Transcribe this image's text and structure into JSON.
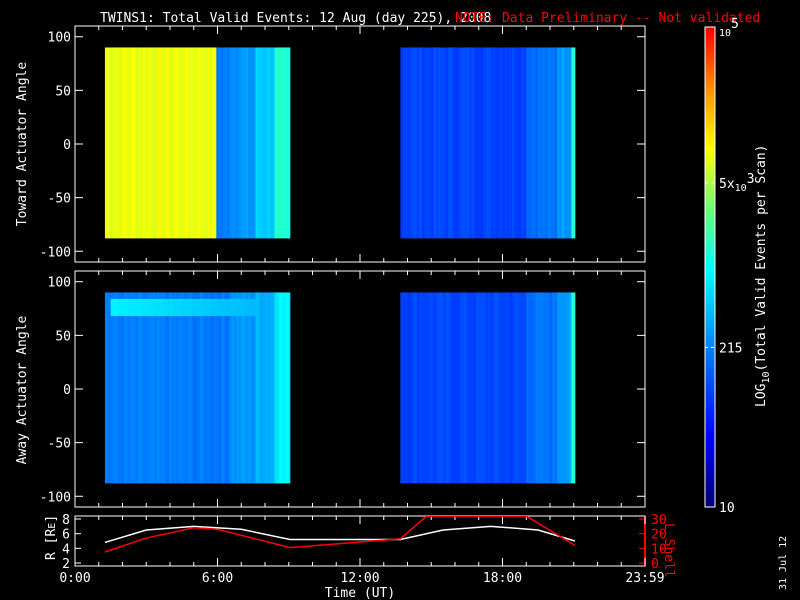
{
  "chart_data": [
    {
      "type": "heatmap",
      "title": "TWINS1: Total Valid Events: 12 Aug (day 225), 2008",
      "note": "NOTE: Data Preliminary -- Not validated",
      "ylabel": "Toward Actuator Angle",
      "ylim": [
        -110,
        110
      ],
      "yticks": [
        "100",
        "50",
        "0",
        "-50",
        "-100"
      ],
      "ytick_values": [
        100,
        50,
        0,
        -50,
        -100
      ],
      "angle_range": [
        -88,
        90
      ],
      "segments_hours_log10": [
        [
          1.26,
          5.95,
          3.95
        ],
        [
          5.95,
          6.5,
          2.3
        ],
        [
          6.5,
          7.6,
          2.45
        ],
        [
          7.6,
          8.4,
          2.75
        ],
        [
          8.4,
          9.05,
          3.1
        ],
        [
          13.7,
          19.0,
          2.0
        ],
        [
          19.0,
          20.3,
          2.25
        ],
        [
          20.3,
          20.9,
          2.5
        ],
        [
          20.9,
          21.05,
          3.2
        ]
      ]
    },
    {
      "type": "heatmap",
      "ylabel": "Away Actuator Angle",
      "ylim": [
        -110,
        110
      ],
      "yticks": [
        "100",
        "50",
        "0",
        "-50",
        "-100"
      ],
      "ytick_values": [
        100,
        50,
        0,
        -50,
        -100
      ],
      "angle_range": [
        -88,
        90
      ],
      "segments_hours_log10": [
        [
          1.26,
          6.5,
          2.3
        ],
        [
          6.5,
          7.6,
          2.45
        ],
        [
          7.6,
          8.4,
          2.6
        ],
        [
          8.4,
          9.05,
          2.95
        ],
        [
          13.7,
          19.0,
          2.0
        ],
        [
          19.0,
          20.3,
          2.25
        ],
        [
          20.3,
          20.9,
          2.5
        ],
        [
          20.9,
          21.05,
          3.1
        ]
      ],
      "band": {
        "angle_range": [
          68,
          84
        ],
        "hours": [
          1.5,
          7.5
        ],
        "log10": 3.0
      }
    },
    {
      "type": "line",
      "xlabel": "Time (UT)",
      "xticks": [
        "0:00",
        "6:00",
        "12:00",
        "18:00",
        "23:59"
      ],
      "xtick_hours": [
        0,
        6,
        12,
        18,
        24
      ],
      "xlim_hours": [
        0,
        24
      ],
      "left_axis": {
        "label": "R [R",
        "label_sub": "E",
        "label_end": "]",
        "ticks": [
          "8",
          "6",
          "4",
          "2"
        ],
        "tick_values": [
          8,
          6,
          4,
          2
        ],
        "ylim": [
          2,
          8
        ]
      },
      "right_axis": {
        "label": "L Shell",
        "ticks": [
          "30",
          "20",
          "10",
          "0"
        ],
        "tick_values": [
          30,
          20,
          10,
          0
        ],
        "ylim": [
          0,
          30
        ],
        "color": "#ff0000"
      },
      "series": [
        {
          "name": "R",
          "color": "#ffffff",
          "x": [
            1.26,
            3,
            5,
            7,
            9.05,
            13.7,
            15.5,
            17.5,
            19.5,
            21.05
          ],
          "y": [
            4.8,
            6.5,
            7.0,
            6.6,
            5.2,
            5.2,
            6.5,
            7.0,
            6.5,
            5.0
          ]
        },
        {
          "name": "L Shell",
          "color": "#ff0000",
          "x": [
            1.26,
            3,
            5,
            6,
            9.05,
            13.7,
            14.8,
            19.0,
            21.05
          ],
          "y": [
            7.5,
            17,
            24,
            23,
            10.5,
            16.5,
            32,
            32,
            12
          ]
        }
      ]
    }
  ],
  "colorbar": {
    "label": "LOG",
    "label_sub": "10",
    "label_rest": "(Total Valid Events per Scan)",
    "ticks": [
      {
        "text": "10",
        "log10": 1
      },
      {
        "text": "215",
        "log10": 2.33
      },
      {
        "text": "5x",
        "sub": "10",
        "sup": "3",
        "log10": 3.7
      },
      {
        "text": "",
        "sub": "10",
        "sup": "5",
        "log10": 5
      }
    ],
    "range_log10": [
      1,
      5
    ]
  },
  "date_stamp": "31 Jul 12"
}
